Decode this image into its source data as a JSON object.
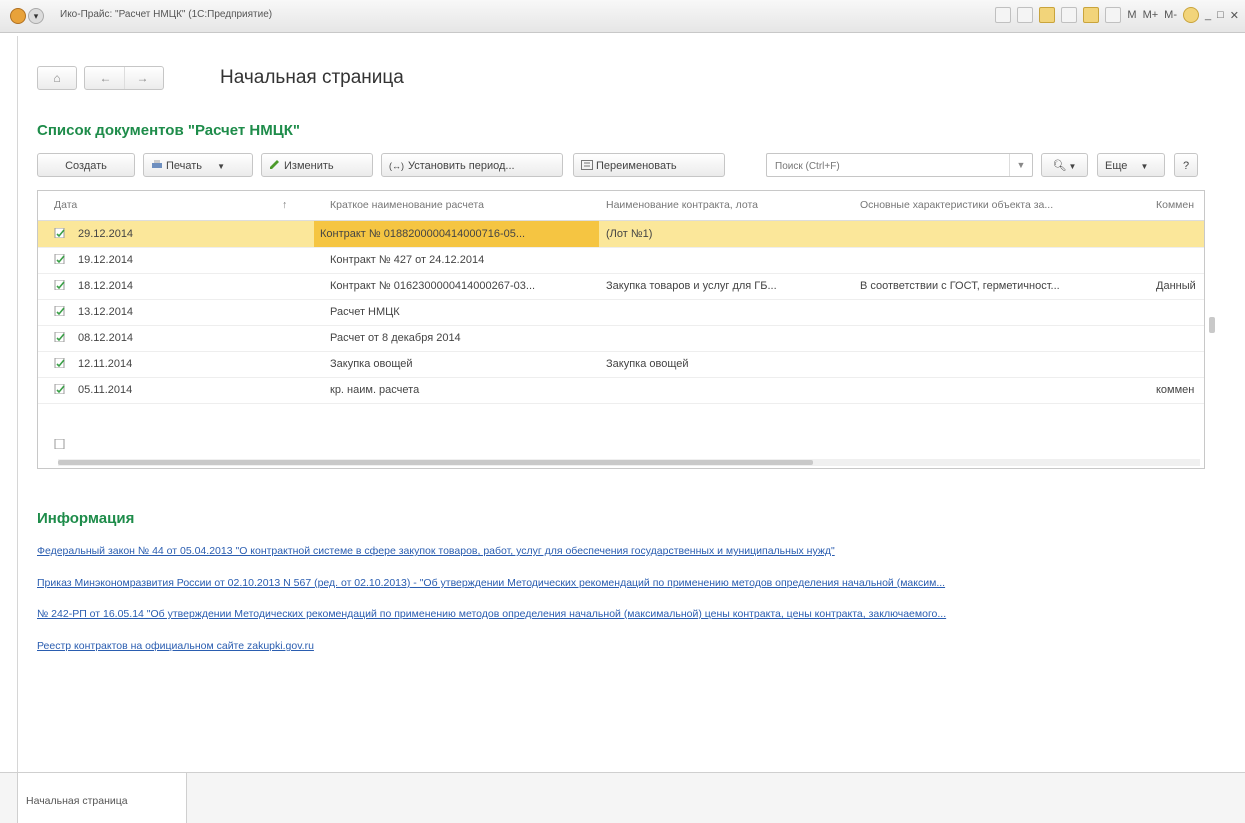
{
  "window": {
    "title": "Ико-Прайс: \"Расчет НМЦК\" (1С:Предприятие)",
    "menu_m": "M",
    "menu_mplus": "M+",
    "menu_mminus": "M-",
    "minimize_glyph": "_",
    "restore_glyph": "□",
    "close_glyph": "✕"
  },
  "nav": {
    "home_glyph": "⌂",
    "back_glyph": "←",
    "forward_glyph": "→",
    "page_title": "Начальная страница"
  },
  "list": {
    "title": "Список документов \"Расчет НМЦК\"",
    "toolbar": {
      "create": "Создать",
      "print": "Печать",
      "edit": "Изменить",
      "set_period": "Установить период...",
      "rename": "Переименовать",
      "search_placeholder": "Поиск (Ctrl+F)",
      "more": "Еще",
      "help": "?"
    },
    "columns": [
      "Дата",
      "Краткое наименование расчета",
      "Наименование контракта, лота",
      "Основные характеристики объекта за...",
      "Коммен"
    ],
    "sort_glyph": "↑",
    "rows": [
      {
        "date": "29.12.2014",
        "short_name": "Контракт № 0188200000414000716-05...",
        "contract": "(Лот №1)",
        "characteristics": "",
        "comment": "",
        "selected": true
      },
      {
        "date": "19.12.2014",
        "short_name": "Контракт № 427 от 24.12.2014",
        "contract": "",
        "characteristics": "",
        "comment": ""
      },
      {
        "date": "18.12.2014",
        "short_name": "Контракт № 0162300000414000267-03...",
        "contract": "Закупка товаров и услуг для ГБ...",
        "characteristics": "В соответствии с ГОСТ, герметичност...",
        "comment": "Данный"
      },
      {
        "date": "13.12.2014",
        "short_name": "Расчет НМЦК",
        "contract": "",
        "characteristics": "",
        "comment": ""
      },
      {
        "date": "08.12.2014",
        "short_name": "Расчет от 8 декабря 2014",
        "contract": "",
        "characteristics": "",
        "comment": ""
      },
      {
        "date": "12.11.2014",
        "short_name": "Закупка овощей",
        "contract": "Закупка овощей",
        "characteristics": "",
        "comment": ""
      },
      {
        "date": "05.11.2014",
        "short_name": "кр. наим. расчета",
        "contract": "",
        "characteristics": "",
        "comment": "коммен"
      }
    ]
  },
  "info": {
    "title": "Информация",
    "links": [
      "Федеральный закон № 44 от 05.04.2013 \"О контрактной системе в сфере закупок товаров, работ, услуг для обеспечения государственных и муниципальных нужд\"",
      "Приказ Минэкономразвития России от 02.10.2013 N 567 (ред. от 02.10.2013) - \"Об утверждении Методических рекомендаций по применению методов определения начальной (максим...",
      "№ 242-РП от 16.05.14 \"Об утверждении Методических рекомендаций по применению методов определения начальной (максимальной) цены контракта, цены контракта, заключаемого...",
      "Реестр контрактов на официальном сайте zakupki.gov.ru"
    ]
  },
  "tabs": {
    "active": "Начальная страница"
  },
  "colors": {
    "section_green": "#1e8c4a",
    "link_blue": "#2a5db0",
    "row_selected": "#fbe79a",
    "cell_highlight": "#f5c542"
  }
}
